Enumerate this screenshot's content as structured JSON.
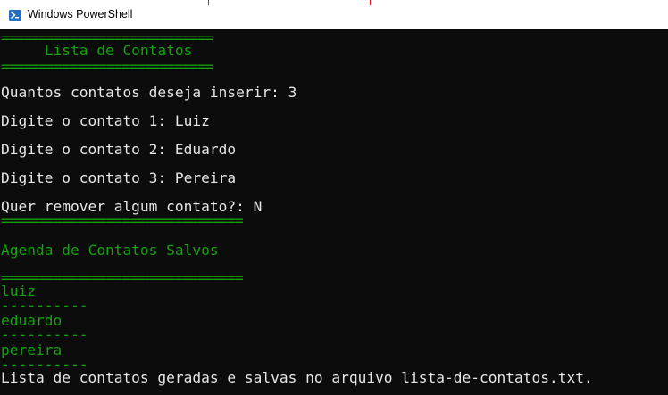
{
  "window": {
    "title": "Windows PowerShell",
    "icon": "powershell-icon"
  },
  "colors": {
    "console_bg": "#0c0c0c",
    "text_white": "#e6e6e6",
    "text_green": "#13a10e"
  },
  "console": {
    "lines": [
      "============================",
      "     Lista de Contatos",
      "============================",
      "Quantos contatos deseja inserir: 3",
      "Digite o contato 1: Luiz",
      "Digite o contato 2: Eduardo",
      "Digite o contato 3: Pereira",
      "Quer remover algum contato?: N",
      "================================",
      "Agenda de Contatos Salvos",
      "================================",
      "luiz",
      "----------",
      "eduardo",
      "----------",
      "pereira",
      "----------",
      "Lista de contatos geradas e salvas no arquivo lista-de-contatos.txt."
    ]
  }
}
